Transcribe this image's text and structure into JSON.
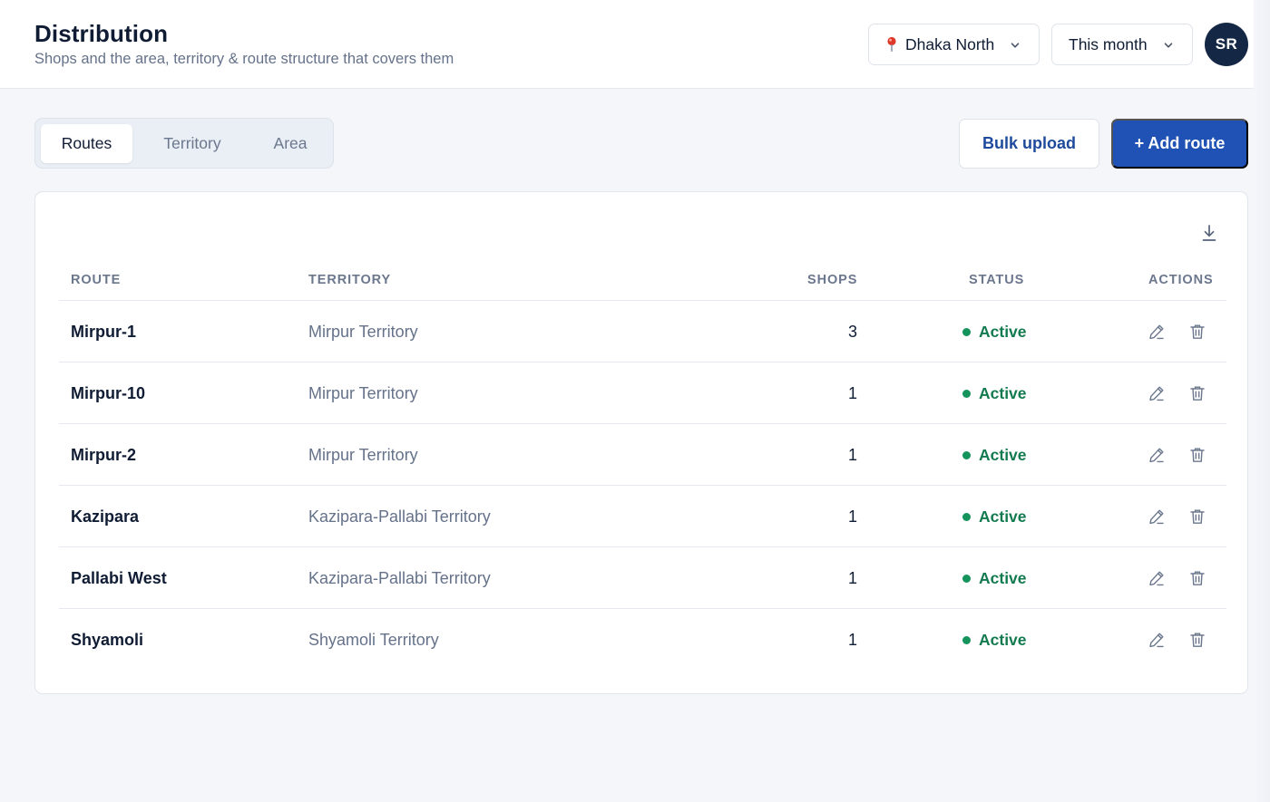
{
  "header": {
    "title": "Distribution",
    "subtitle": "Shops and the area, territory & route structure that covers them",
    "location_select": {
      "value": "Dhaka North",
      "icon": "map-pin-icon"
    },
    "period_select": {
      "value": "This month"
    },
    "avatar_initials": "SR"
  },
  "tabs": [
    {
      "label": "Routes",
      "active": true
    },
    {
      "label": "Territory",
      "active": false
    },
    {
      "label": "Area",
      "active": false
    }
  ],
  "actions": {
    "bulk_upload_label": "Bulk upload",
    "add_route_label": "+ Add route"
  },
  "table": {
    "columns": [
      "ROUTE",
      "TERRITORY",
      "SHOPS",
      "STATUS",
      "ACTIONS"
    ],
    "rows": [
      {
        "route": "Mirpur-1",
        "territory": "Mirpur Territory",
        "shops": "3",
        "status": "Active"
      },
      {
        "route": "Mirpur-10",
        "territory": "Mirpur Territory",
        "shops": "1",
        "status": "Active"
      },
      {
        "route": "Mirpur-2",
        "territory": "Mirpur Territory",
        "shops": "1",
        "status": "Active"
      },
      {
        "route": "Kazipara",
        "territory": "Kazipara-Pallabi Territory",
        "shops": "1",
        "status": "Active"
      },
      {
        "route": "Pallabi West",
        "territory": "Kazipara-Pallabi Territory",
        "shops": "1",
        "status": "Active"
      },
      {
        "route": "Shyamoli",
        "territory": "Shyamoli Territory",
        "shops": "1",
        "status": "Active"
      }
    ]
  },
  "colors": {
    "primary": "#1f52b4",
    "avatar_bg": "#142846",
    "status_active": "#127a4e",
    "pin": "#e0392b"
  }
}
